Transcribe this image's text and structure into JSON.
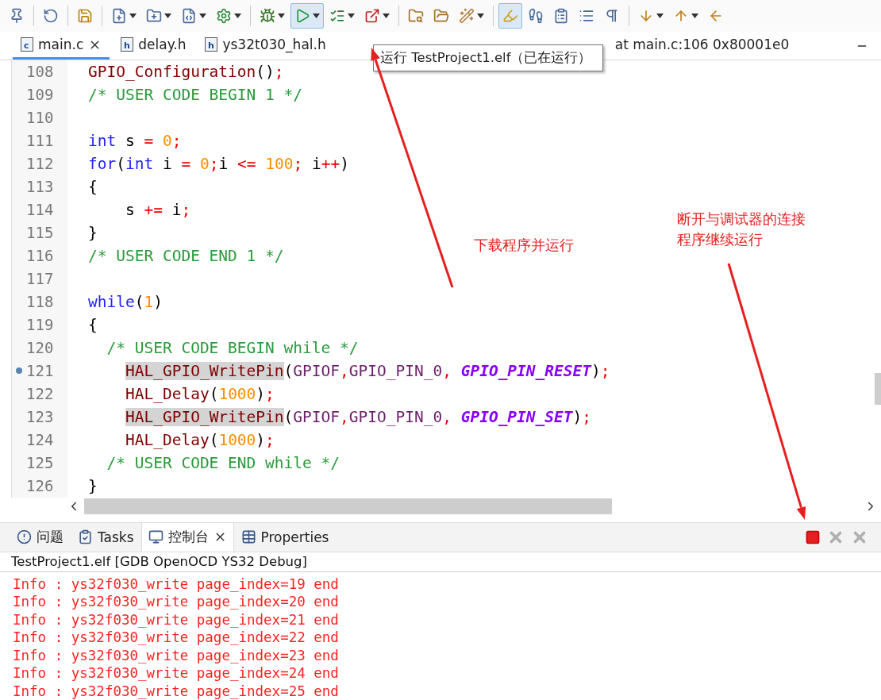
{
  "toolbar": [
    {
      "kind": "pin",
      "dropdown": false,
      "pressed": false
    },
    {
      "kind": "sep"
    },
    {
      "kind": "rotate",
      "dropdown": false,
      "pressed": false
    },
    {
      "kind": "sep"
    },
    {
      "kind": "save",
      "dropdown": false,
      "pressed": false
    },
    {
      "kind": "sep"
    },
    {
      "kind": "file-plus",
      "dropdown": true,
      "pressed": false
    },
    {
      "kind": "folder-plus",
      "dropdown": true,
      "pressed": false
    },
    {
      "kind": "file-code",
      "dropdown": true,
      "pressed": false
    },
    {
      "kind": "gear",
      "dropdown": true,
      "pressed": false
    },
    {
      "kind": "sep"
    },
    {
      "kind": "bug",
      "dropdown": true,
      "pressed": false
    },
    {
      "kind": "run",
      "dropdown": true,
      "pressed": true
    },
    {
      "kind": "run-list",
      "dropdown": true,
      "pressed": false
    },
    {
      "kind": "run-ext",
      "dropdown": true,
      "pressed": false
    },
    {
      "kind": "sep"
    },
    {
      "kind": "folder-search",
      "dropdown": false,
      "pressed": false
    },
    {
      "kind": "folder-open",
      "dropdown": false,
      "pressed": false
    },
    {
      "kind": "wand",
      "dropdown": true,
      "pressed": false
    },
    {
      "kind": "sep"
    },
    {
      "kind": "pen",
      "dropdown": false,
      "pressed": true
    },
    {
      "kind": "footprints",
      "dropdown": false,
      "pressed": false
    },
    {
      "kind": "clipboard",
      "dropdown": false,
      "pressed": false
    },
    {
      "kind": "list",
      "dropdown": false,
      "pressed": false
    },
    {
      "kind": "pilcrow",
      "dropdown": false,
      "pressed": false
    },
    {
      "kind": "sep"
    },
    {
      "kind": "arrow-down",
      "dropdown": true,
      "pressed": false
    },
    {
      "kind": "arrow-up",
      "dropdown": true,
      "pressed": false
    },
    {
      "kind": "arrow-left",
      "dropdown": false,
      "pressed": false
    }
  ],
  "editor_tabs": [
    {
      "kind": "file",
      "badge": "c",
      "label": "main.c",
      "selected": true,
      "closable": true
    },
    {
      "kind": "file",
      "badge": "h",
      "label": "delay.h",
      "selected": false,
      "closable": false
    },
    {
      "kind": "file",
      "badge": "h",
      "label": "ys32t030_hal.h",
      "selected": false,
      "closable": false
    },
    {
      "kind": "debug-frame",
      "label": "at main.c:106 0x80001e0",
      "selected": false,
      "closable": false
    }
  ],
  "tooltip": "运行 TestProject1.elf（已在运行）",
  "code_lines": [
    {
      "number": "108",
      "marker": false,
      "tokens": [
        {
          "kind": "fn",
          "text": "GPIO_Configuration"
        },
        {
          "kind": "plain",
          "text": "()"
        },
        {
          "kind": "op",
          "text": ";"
        }
      ]
    },
    {
      "number": "109",
      "marker": false,
      "tokens": [
        {
          "kind": "comment",
          "text": "/* USER CODE BEGIN 1 */"
        }
      ]
    },
    {
      "number": "110",
      "marker": false
    },
    {
      "number": "111",
      "marker": false,
      "tokens": [
        {
          "kind": "kw",
          "text": "int"
        },
        {
          "kind": "plain",
          "text": " s "
        },
        {
          "kind": "op",
          "text": "="
        },
        {
          "kind": "num",
          "text": " 0"
        },
        {
          "kind": "op",
          "text": ";"
        }
      ]
    },
    {
      "number": "112",
      "marker": false,
      "tokens": [
        {
          "kind": "kw",
          "text": "for"
        },
        {
          "kind": "plain",
          "text": "("
        },
        {
          "kind": "kw",
          "text": "int"
        },
        {
          "kind": "plain",
          "text": " i "
        },
        {
          "kind": "op",
          "text": "="
        },
        {
          "kind": "num",
          "text": " 0"
        },
        {
          "kind": "op",
          "text": ";"
        },
        {
          "kind": "plain",
          "text": "i "
        },
        {
          "kind": "op",
          "text": "<="
        },
        {
          "kind": "num",
          "text": " 100"
        },
        {
          "kind": "op",
          "text": ";"
        },
        {
          "kind": "plain",
          "text": " i"
        },
        {
          "kind": "op",
          "text": "++"
        },
        {
          "kind": "plain",
          "text": ")"
        }
      ]
    },
    {
      "number": "113",
      "marker": false,
      "tokens": [
        {
          "kind": "plain",
          "text": "{"
        }
      ]
    },
    {
      "number": "114",
      "marker": false,
      "tokens": [
        {
          "kind": "plain",
          "text": "    s "
        },
        {
          "kind": "op",
          "text": "+="
        },
        {
          "kind": "plain",
          "text": " i"
        },
        {
          "kind": "op",
          "text": ";"
        }
      ]
    },
    {
      "number": "115",
      "marker": false,
      "tokens": [
        {
          "kind": "plain",
          "text": "}"
        }
      ]
    },
    {
      "number": "116",
      "marker": false,
      "tokens": [
        {
          "kind": "comment",
          "text": "/* USER CODE END 1 */"
        }
      ]
    },
    {
      "number": "117",
      "marker": false
    },
    {
      "number": "118",
      "marker": false,
      "tokens": [
        {
          "kind": "kw",
          "text": "while"
        },
        {
          "kind": "plain",
          "text": "("
        },
        {
          "kind": "num",
          "text": "1"
        },
        {
          "kind": "plain",
          "text": ")"
        }
      ]
    },
    {
      "number": "119",
      "marker": false,
      "tokens": [
        {
          "kind": "plain",
          "text": "{"
        }
      ]
    },
    {
      "number": "120",
      "marker": false,
      "tokens": [
        {
          "kind": "comment",
          "text": "  /* USER CODE BEGIN while */"
        }
      ]
    },
    {
      "number": "121",
      "marker": true,
      "tokens": [
        {
          "kind": "fn-hl",
          "text": "    HAL_GPIO_WritePin"
        },
        {
          "kind": "plain",
          "text": "("
        },
        {
          "kind": "arg",
          "text": "GPIOF"
        },
        {
          "kind": "op",
          "text": ","
        },
        {
          "kind": "arg",
          "text": "GPIO_PIN_0"
        },
        {
          "kind": "op",
          "text": ","
        },
        {
          "kind": "macro",
          "text": " GPIO_PIN_RESET"
        },
        {
          "kind": "plain",
          "text": ")"
        },
        {
          "kind": "op",
          "text": ";"
        }
      ]
    },
    {
      "number": "122",
      "marker": false,
      "tokens": [
        {
          "kind": "fn",
          "text": "    HAL_Delay"
        },
        {
          "kind": "plain",
          "text": "("
        },
        {
          "kind": "num",
          "text": "1000"
        },
        {
          "kind": "plain",
          "text": ")"
        },
        {
          "kind": "op",
          "text": ";"
        }
      ]
    },
    {
      "number": "123",
      "marker": false,
      "tokens": [
        {
          "kind": "fn-hl",
          "text": "    HAL_GPIO_WritePin"
        },
        {
          "kind": "plain",
          "text": "("
        },
        {
          "kind": "arg",
          "text": "GPIOF"
        },
        {
          "kind": "op",
          "text": ","
        },
        {
          "kind": "arg",
          "text": "GPIO_PIN_0"
        },
        {
          "kind": "op",
          "text": ","
        },
        {
          "kind": "macro",
          "text": " GPIO_PIN_SET"
        },
        {
          "kind": "plain",
          "text": ")"
        },
        {
          "kind": "op",
          "text": ";"
        }
      ]
    },
    {
      "number": "124",
      "marker": false,
      "tokens": [
        {
          "kind": "fn",
          "text": "    HAL_Delay"
        },
        {
          "kind": "plain",
          "text": "("
        },
        {
          "kind": "num",
          "text": "1000"
        },
        {
          "kind": "plain",
          "text": ")"
        },
        {
          "kind": "op",
          "text": ";"
        }
      ]
    },
    {
      "number": "125",
      "marker": false,
      "tokens": [
        {
          "kind": "comment",
          "text": "  /* USER CODE END while */"
        }
      ]
    },
    {
      "number": "126",
      "marker": false,
      "tokens": [
        {
          "kind": "plain",
          "text": "}"
        }
      ]
    }
  ],
  "panel_tabs": [
    {
      "kind": "problems",
      "label": "问题",
      "selected": false,
      "closable": false
    },
    {
      "kind": "tasks",
      "label": "Tasks",
      "selected": false,
      "closable": false
    },
    {
      "kind": "console",
      "label": "控制台",
      "selected": true,
      "closable": true
    },
    {
      "kind": "properties",
      "label": "Properties",
      "selected": false,
      "closable": false
    }
  ],
  "panel_actions": [
    {
      "kind": "terminate",
      "disabled": false
    },
    {
      "kind": "remove",
      "disabled": true
    },
    {
      "kind": "remove-all",
      "disabled": true
    }
  ],
  "console_title": "TestProject1.elf [GDB OpenOCD YS32 Debug]",
  "console_lines": [
    "Info : ys32f030_write page_index=19 end",
    "Info : ys32f030_write page_index=20 end",
    "Info : ys32f030_write page_index=21 end",
    "Info : ys32f030_write page_index=22 end",
    "Info : ys32f030_write page_index=23 end",
    "Info : ys32f030_write page_index=24 end",
    "Info : ys32f030_write page_index=25 end"
  ],
  "annotations": [
    {
      "lines": [
        "下载程序并运行"
      ]
    },
    {
      "lines": [
        "断开与调试器的连接",
        "程序继续运行"
      ]
    }
  ]
}
